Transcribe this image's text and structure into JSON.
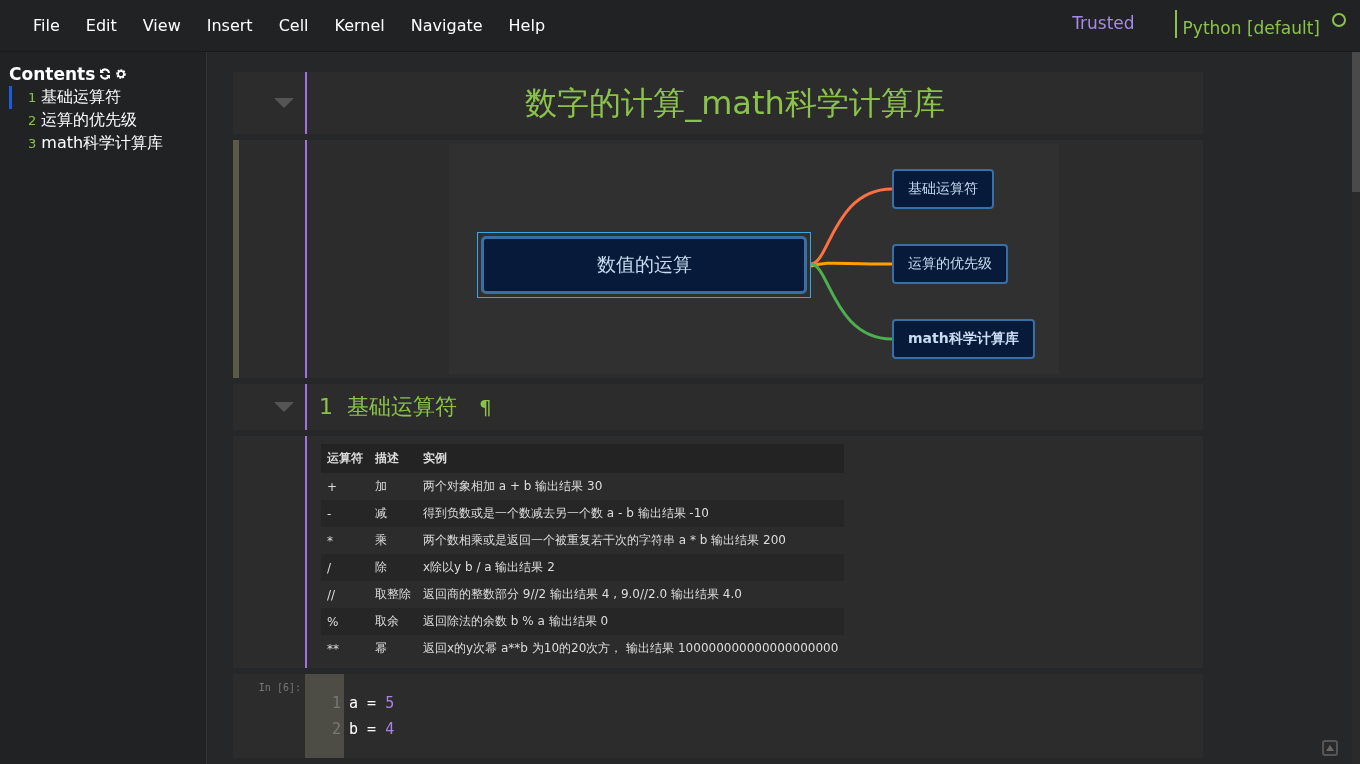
{
  "menu": [
    "File",
    "Edit",
    "View",
    "Insert",
    "Cell",
    "Kernel",
    "Navigate",
    "Help"
  ],
  "status": {
    "trusted": "Trusted",
    "kernel": "Python [default]",
    "busy": false
  },
  "toc": {
    "title": "Contents",
    "items": [
      {
        "number": "1",
        "label": "基础运算符",
        "selected": true
      },
      {
        "number": "2",
        "label": "运算的优先级",
        "selected": false
      },
      {
        "number": "3",
        "label": "math科学计算库",
        "selected": false
      }
    ]
  },
  "title_cell": {
    "title": "数字的计算_math科学计算库",
    "collapsed": false
  },
  "mindmap": {
    "root": "数值的运算",
    "branches": [
      {
        "label": "基础运算符",
        "color": "#ff7043"
      },
      {
        "label": "运算的优先级",
        "color": "#ffa000"
      },
      {
        "label": "math科学计算库",
        "color": "#4caf50"
      }
    ]
  },
  "section": {
    "number": "1",
    "title": "基础运算符",
    "anchor": "¶",
    "collapsed": false
  },
  "table": {
    "columns": [
      "运算符",
      "描述",
      "实例"
    ],
    "rows": [
      [
        "+",
        "加",
        "两个对象相加 a + b 输出结果 30"
      ],
      [
        "-",
        "减",
        "得到负数或是一个数减去另一个数 a - b 输出结果 -10"
      ],
      [
        "*",
        "乘",
        "两个数相乘或是返回一个被重复若干次的字符串 a * b 输出结果 200"
      ],
      [
        "/",
        "除",
        "x除以y b / a 输出结果 2"
      ],
      [
        "//",
        "取整除",
        "返回商的整数部分 9//2 输出结果 4 , 9.0//2.0 输出结果 4.0"
      ],
      [
        "%",
        "取余",
        "返回除法的余数 b % a 输出结果 0"
      ],
      [
        "**",
        "幂",
        "返回x的y次幂 a**b 为10的20次方， 输出结果 100000000000000000000"
      ]
    ]
  },
  "code_cell": {
    "prompt": "In [6]:",
    "lines": [
      {
        "number": "1",
        "code": "a = ",
        "value": "5"
      },
      {
        "number": "2",
        "code": "b = ",
        "value": "4"
      }
    ]
  }
}
